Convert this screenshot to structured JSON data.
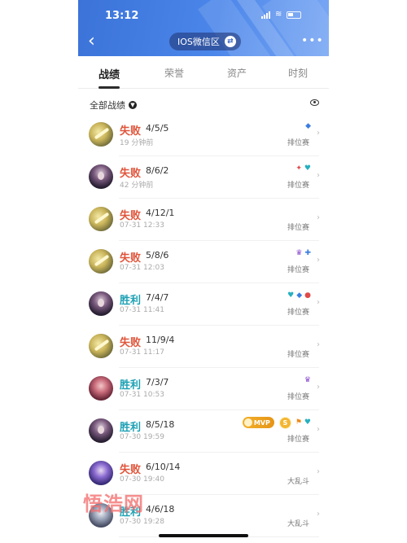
{
  "status_bar": {
    "time": "13:12"
  },
  "header": {
    "back_icon": "chevron-left-icon",
    "zone_label": "IOS微信区",
    "swap_icon": "swap-icon",
    "more_icon": "more-icon"
  },
  "tabs": [
    {
      "label": "战绩",
      "active": true
    },
    {
      "label": "荣誉",
      "active": false
    },
    {
      "label": "资产",
      "active": false
    },
    {
      "label": "时刻",
      "active": false
    }
  ],
  "filter": {
    "label": "全部战绩",
    "icon": "chevron-down-icon",
    "eye_icon": "eye-icon"
  },
  "colors": {
    "loss": "#e0553b",
    "win": "#1ea1b4",
    "header_blue": "#3b73d8"
  },
  "matches": [
    {
      "result": "失败",
      "kda": "4/5/5",
      "time": "19 分钟前",
      "mode": "排位赛",
      "badges": [
        "◆"
      ]
    },
    {
      "result": "失败",
      "kda": "8/6/2",
      "time": "42 分钟前",
      "mode": "排位赛",
      "badges": [
        "✦",
        "♥"
      ]
    },
    {
      "result": "失败",
      "kda": "4/12/1",
      "time": "07-31 12:33",
      "mode": "排位赛",
      "badges": []
    },
    {
      "result": "失败",
      "kda": "5/8/6",
      "time": "07-31 12:03",
      "mode": "排位赛",
      "badges": [
        "♛",
        "✚"
      ]
    },
    {
      "result": "胜利",
      "kda": "7/4/7",
      "time": "07-31 11:41",
      "mode": "排位赛",
      "badges": [
        "♥",
        "◆",
        "●"
      ]
    },
    {
      "result": "失败",
      "kda": "11/9/4",
      "time": "07-31 11:17",
      "mode": "排位赛",
      "badges": []
    },
    {
      "result": "胜利",
      "kda": "7/3/7",
      "time": "07-31 10:53",
      "mode": "排位赛",
      "badges": [
        "♛"
      ]
    },
    {
      "result": "胜利",
      "kda": "8/5/18",
      "time": "07-30 19:59",
      "mode": "排位赛",
      "mvp": "MVP",
      "s_badge": "S",
      "badges": [
        "⚑",
        "♥"
      ]
    },
    {
      "result": "失败",
      "kda": "6/10/14",
      "time": "07-30 19:40",
      "mode": "大乱斗",
      "badges": []
    },
    {
      "result": "胜利",
      "kda": "4/6/18",
      "time": "07-30 19:28",
      "mode": "大乱斗",
      "badges": []
    }
  ],
  "watermark": "悟浩网"
}
